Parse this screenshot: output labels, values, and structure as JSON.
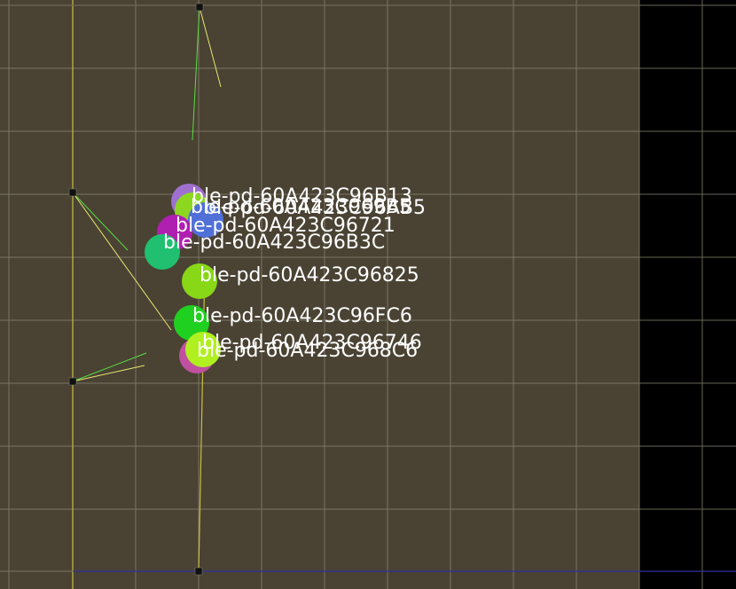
{
  "colors": {
    "floor": "#4a4233",
    "outside": "#000000",
    "grid_line": "#8c8877",
    "wall_line": "#c8c040",
    "boundary_line": "#3030a0",
    "anchor": "#111111",
    "ray_green": "#55e040",
    "ray_yellow": "#e8e870",
    "label_text": "#ffffff"
  },
  "anchors": [
    {
      "id": "anchor-top"
    },
    {
      "id": "anchor-upper-left"
    },
    {
      "id": "anchor-lower-left"
    },
    {
      "id": "anchor-bottom"
    }
  ],
  "devices": [
    {
      "name": "ble-pd-60A423C96B13",
      "color": "#a070d0"
    },
    {
      "name": "ble-pd-60A423C96AB5",
      "color": "#8cd820"
    },
    {
      "name": "ble-pd-60A423C969B5",
      "color": "#5070d8"
    },
    {
      "name": "ble-pd-60A423C96721",
      "color": "#b020b0"
    },
    {
      "name": "ble-pd-60A423C96B3C",
      "color": "#20c070"
    },
    {
      "name": "ble-pd-60A423C96825",
      "color": "#88d818"
    },
    {
      "name": "ble-pd-60A423C96FC6",
      "color": "#20d020"
    },
    {
      "name": "ble-pd-60A423C96746",
      "color": "#c050a0"
    },
    {
      "name": "ble-pd-60A423C968C6",
      "color": "#b0f020"
    }
  ]
}
